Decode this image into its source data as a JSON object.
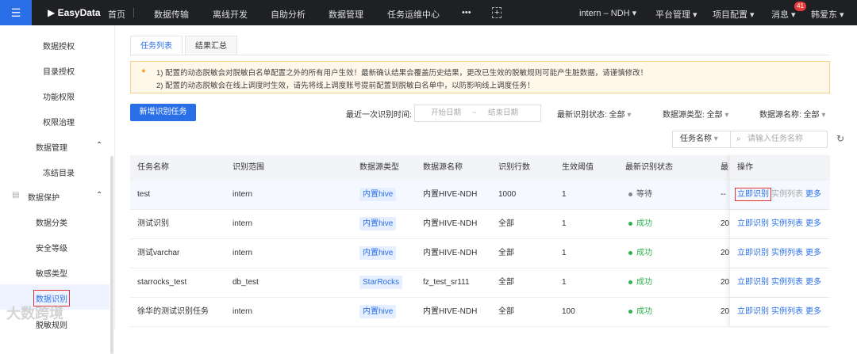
{
  "topbar": {
    "logo": "EasyData",
    "nav": [
      "首页",
      "数据传输",
      "离线开发",
      "自助分析",
      "数据管理",
      "任务运维中心"
    ],
    "more": "•••",
    "project": "intern – NDH",
    "platform": "平台管理",
    "project_config": "项目配置",
    "messages": "消息",
    "message_count": "41",
    "user": "韩爱东"
  },
  "sidebar": {
    "items": [
      {
        "label": "数据授权",
        "level": 2
      },
      {
        "label": "目录授权",
        "level": 2
      },
      {
        "label": "功能权限",
        "level": 2
      },
      {
        "label": "权限治理",
        "level": 2
      },
      {
        "label": "数据管理",
        "level": 1,
        "expanded": true
      },
      {
        "label": "冻结目录",
        "level": 2
      },
      {
        "label": "数据保护",
        "level": 0,
        "expanded": true
      },
      {
        "label": "数据分类",
        "level": 1
      },
      {
        "label": "安全等级",
        "level": 1
      },
      {
        "label": "敏感类型",
        "level": 1
      },
      {
        "label": "数据识别",
        "level": 1,
        "selected": true
      },
      {
        "label": "脱敏规则",
        "level": 1
      }
    ]
  },
  "tabs": [
    {
      "label": "任务列表",
      "active": true
    },
    {
      "label": "结果汇总",
      "active": false
    }
  ],
  "alert": {
    "line1": "1) 配置的动态脱敏会对脱敏白名单配置之外的所有用户生效！最新确认结果会覆盖历史结果，更改已生效的脱敏规则可能产生脏数据，请谨慎修改！",
    "line2": "2) 配置的动态脱敏会在线上调度时生效，请先将线上调度账号提前配置到脱敏白名单中，以防影响线上调度任务！"
  },
  "toolbar": {
    "new_task": "新增识别任务",
    "last_time_label": "最近一次识别时间:",
    "start_placeholder": "开始日期",
    "range_sep": "~",
    "end_placeholder": "结束日期",
    "status_filter": "最新识别状态: 全部",
    "type_filter": "数据源类型: 全部",
    "name_filter": "数据源名称: 全部",
    "search_field": "任务名称",
    "search_placeholder": "请输入任务名称"
  },
  "table": {
    "columns": [
      "任务名称",
      "识别范围",
      "数据源类型",
      "数据源名称",
      "识别行数",
      "生效阈值",
      "最新识别状态",
      "最",
      "操作"
    ],
    "rows": [
      {
        "name": "test",
        "scope": "intern",
        "type": "内置hive",
        "source": "内置HIVE-NDH",
        "rows": "1000",
        "threshold": "1",
        "status": "等待",
        "status_color": "#888888",
        "last": "--"
      },
      {
        "name": "测试识别",
        "scope": "intern",
        "type": "内置hive",
        "source": "内置HIVE-NDH",
        "rows": "全部",
        "threshold": "1",
        "status": "成功",
        "status_color": "#2eb34e",
        "last": "20"
      },
      {
        "name": "测试varchar",
        "scope": "intern",
        "type": "内置hive",
        "source": "内置HIVE-NDH",
        "rows": "全部",
        "threshold": "1",
        "status": "成功",
        "status_color": "#2eb34e",
        "last": "20"
      },
      {
        "name": "starrocks_test",
        "scope": "db_test",
        "type": "StarRocks",
        "source": "fz_test_sr111",
        "rows": "全部",
        "threshold": "1",
        "status": "成功",
        "status_color": "#2eb34e",
        "last": "20"
      },
      {
        "name": "徐华的测试识别任务",
        "scope": "intern",
        "type": "内置hive",
        "source": "内置HIVE-NDH",
        "rows": "全部",
        "threshold": "100",
        "status": "成功",
        "status_color": "#2eb34e",
        "last": "20"
      }
    ],
    "actions": [
      "立即识别",
      "实例列表",
      "更多"
    ]
  },
  "watermark": "大数跨境"
}
